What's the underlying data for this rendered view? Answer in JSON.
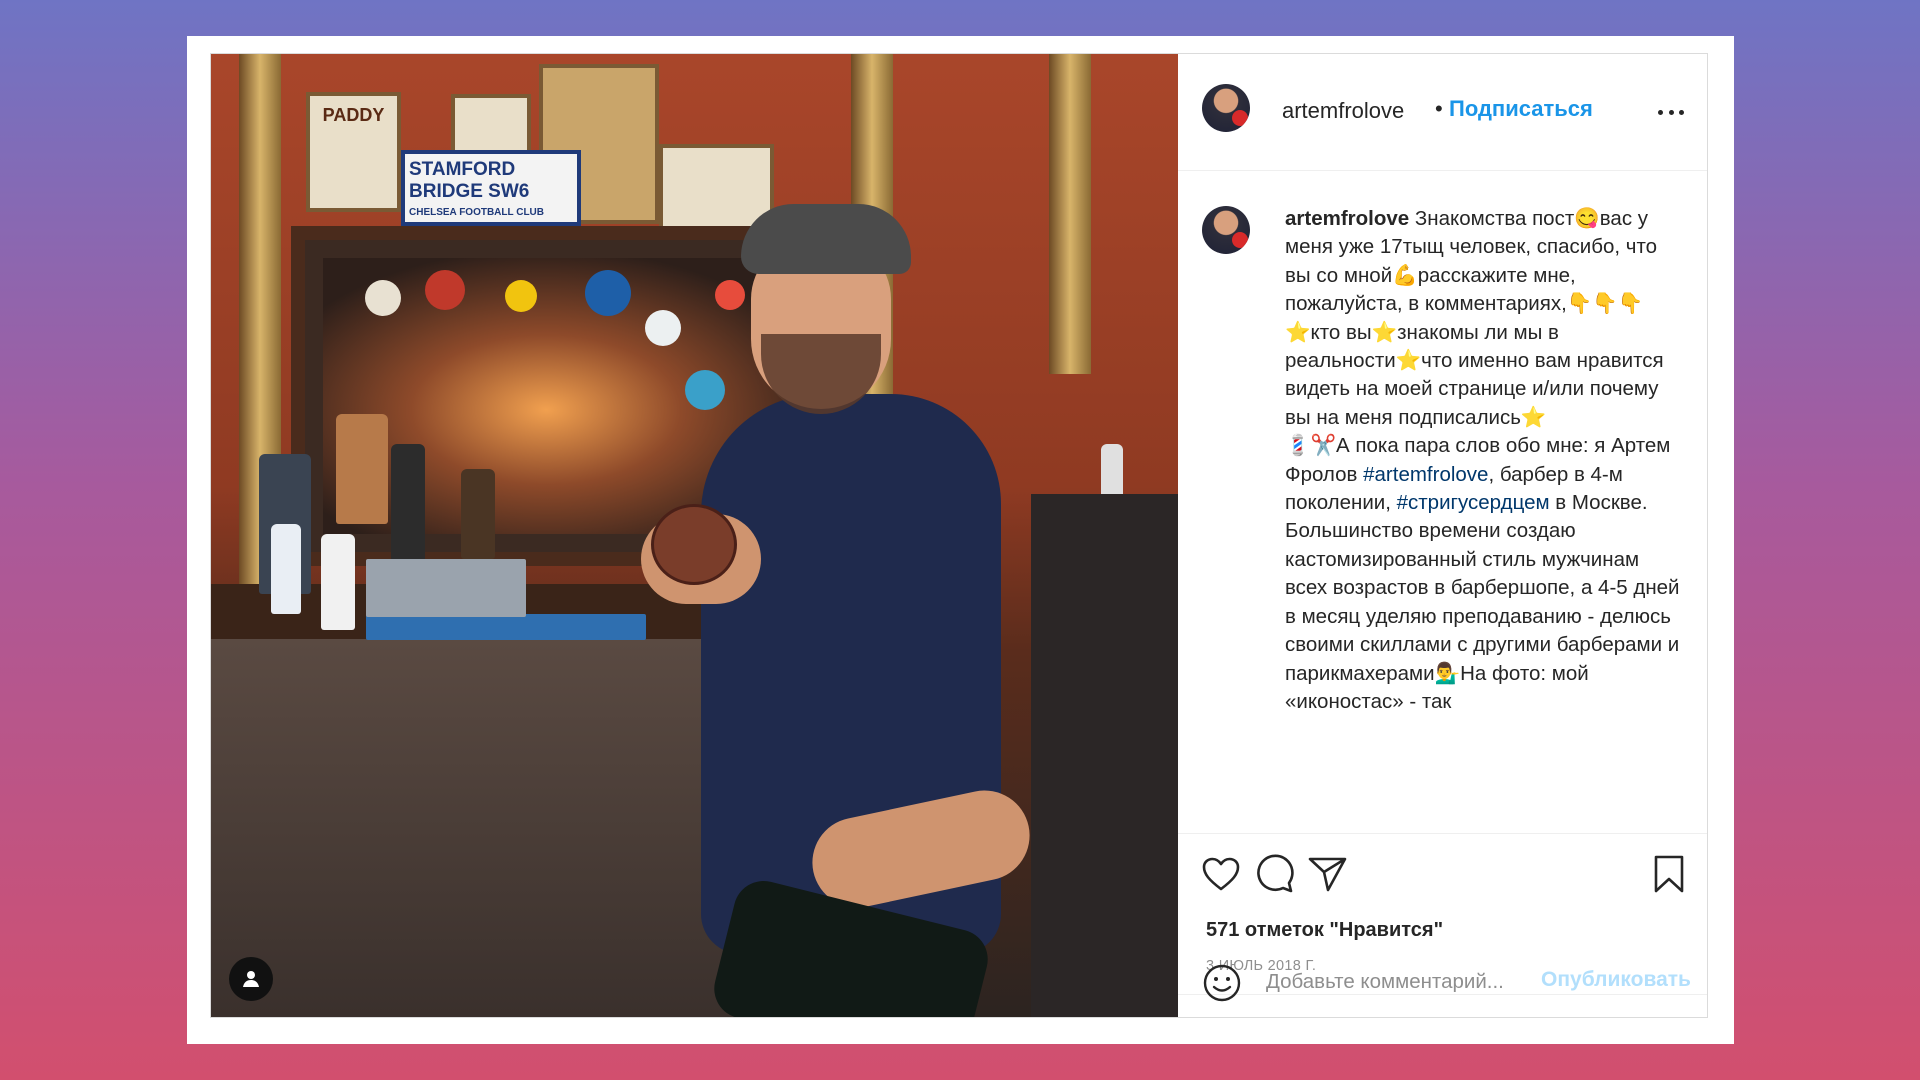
{
  "post": {
    "author": "artemfrolove",
    "header_dot": "•",
    "follow_label": "Подписаться",
    "photo": {
      "sign_top": "STAMFORD",
      "sign_mid": "BRIDGE SW6",
      "sign_bottom": "CHELSEA FOOTBALL CLUB",
      "plaque": "PADDY"
    },
    "caption_parts": [
      "Знакомства пост😋вас у меня уже 17тыщ человек, спасибо, что вы со мной💪расскажите мне, пожалуйста, в комментариях,👇👇👇 ⭐кто вы⭐знакомы ли мы в реальности⭐что именно вам нравится видеть на моей странице и/или почему вы на меня подписались⭐\n💈✂️А пока пара слов обо мне: я Артем Фролов ",
      "#artemfrolove",
      ", барбер в 4-м поколении, ",
      "#стригусердцем",
      " в Москве. Большинство времени создаю кастомизированный стиль мужчинам всех возрастов в барбершопе, а 4-5 дней в месяц уделяю преподаванию - делюсь своими скиллами с другими барберами и парикмахерами💁‍♂️На фото: мой «иконостас» - так"
    ],
    "likes": "571 отметок \"Нравится\"",
    "date": "3 ИЮЛЬ 2018 Г.",
    "comment_placeholder": "Добавьте комментарий...",
    "publish_label": "Опубликовать"
  },
  "icons": {
    "more": "more-options-icon",
    "like": "heart-icon",
    "comment": "comment-icon",
    "share": "share-icon",
    "save": "bookmark-icon",
    "emoji": "emoji-icon",
    "user_tag": "user-tag-icon"
  },
  "colors": {
    "accent": "#1a95e8",
    "hashtag": "#00376b",
    "publish_disabled": "#b2dffc",
    "muted": "#8e8e8e"
  }
}
